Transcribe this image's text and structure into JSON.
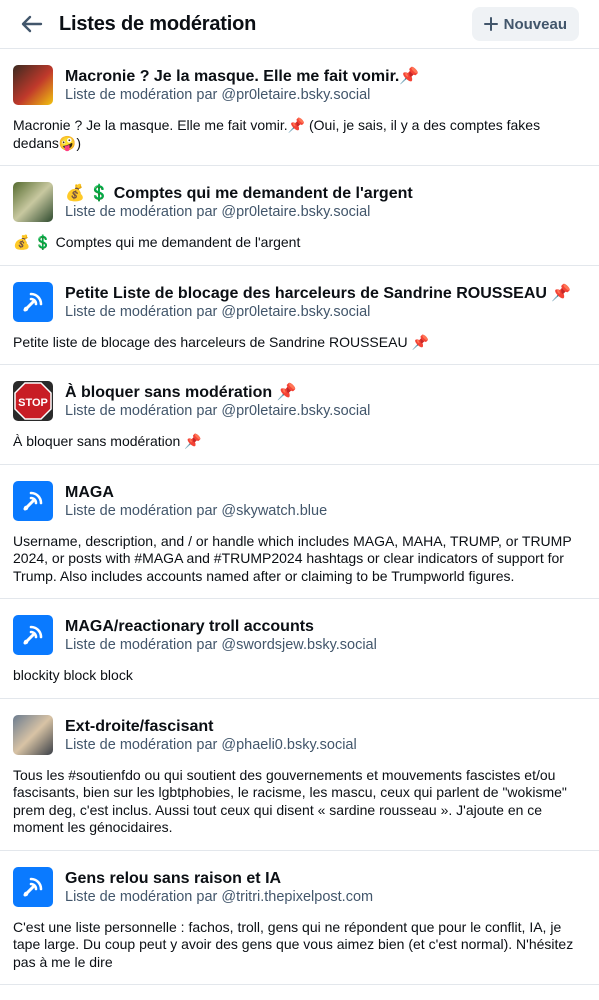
{
  "header": {
    "title": "Listes de modération",
    "new_button": "Nouveau"
  },
  "lists": [
    {
      "avatar": "photo",
      "title": "Macronie ? Je la masque. Elle me fait vomir.📌",
      "subtitle": "Liste de modération par @pr0letaire.bsky.social",
      "description": "Macronie ? Je la masque. Elle me fait vomir.📌 (Oui, je sais, il y a des comptes fakes dedans🤪)"
    },
    {
      "avatar": "photo",
      "title": "💰 💲 Comptes qui me demandent de l'argent",
      "subtitle": "Liste de modération par @pr0letaire.bsky.social",
      "description": "💰 💲 Comptes qui me demandent de l'argent"
    },
    {
      "avatar": "list-icon",
      "title": "Petite Liste de blocage des harceleurs de Sandrine ROUSSEAU 📌",
      "subtitle": "Liste de modération par @pr0letaire.bsky.social",
      "description": "Petite liste de blocage des harceleurs de Sandrine ROUSSEAU 📌"
    },
    {
      "avatar": "stop-sign",
      "title": "À bloquer sans modération 📌",
      "subtitle": "Liste de modération par @pr0letaire.bsky.social",
      "description": "À bloquer sans modération 📌"
    },
    {
      "avatar": "list-icon",
      "title": "MAGA",
      "subtitle": "Liste de modération par @skywatch.blue",
      "description": "Username, description, and / or handle which includes MAGA, MAHA, TRUMP, or TRUMP 2024, or posts with #MAGA and #TRUMP2024 hashtags or clear indicators of support for Trump. Also includes accounts named after or claiming to be Trumpworld figures."
    },
    {
      "avatar": "list-icon",
      "title": "MAGA/reactionary troll accounts",
      "subtitle": "Liste de modération par @swordsjew.bsky.social",
      "description": "blockity block block"
    },
    {
      "avatar": "photo",
      "title": "Ext-droite/fascisant",
      "subtitle": "Liste de modération par @phaeli0.bsky.social",
      "description": "Tous les #soutienfdo ou qui soutient des gouvernements et mouvements fascistes et/ou fascisants, bien sur les lgbtphobies, le racisme, les mascu, ceux qui parlent de \"wokisme\" prem deg, c'est inclus. Aussi tout ceux qui disent « sardine rousseau ». J'ajoute en ce moment les génocidaires."
    },
    {
      "avatar": "list-icon",
      "title": "Gens relou sans raison et IA",
      "subtitle": "Liste de modération par @tritri.thepixelpost.com",
      "description": "C'est une liste personnelle : fachos, troll, gens qui ne répondent que pour le conflit, IA, je tape large. Du coup peut y avoir des gens que vous aimez bien (et c'est normal). N'hésitez pas à me le dire"
    }
  ],
  "colors": {
    "accent": "#0a7aff",
    "subtext": "#42566b",
    "border": "#e3e7ec"
  }
}
